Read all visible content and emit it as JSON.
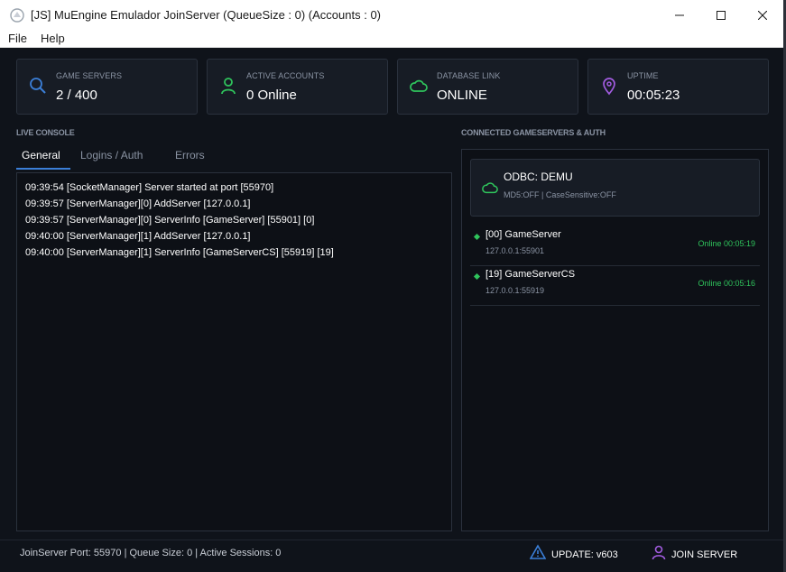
{
  "window": {
    "title": "[JS] MuEngine Emulador JoinServer (QueueSize : 0) (Accounts : 0)"
  },
  "menu": [
    "File",
    "Help"
  ],
  "cards": [
    {
      "label": "GAME SERVERS",
      "value": "2 / 400",
      "icon": "search-icon",
      "color": "#3b7fd8"
    },
    {
      "label": "ACTIVE ACCOUNTS",
      "value": "0 Online",
      "icon": "user-icon",
      "color": "#2fc45c"
    },
    {
      "label": "DATABASE LINK",
      "value": "ONLINE",
      "icon": "cloud-icon",
      "color": "#2fc45c"
    },
    {
      "label": "UPTIME",
      "value": "00:05:23",
      "icon": "location-pin-icon",
      "color": "#a25ce0"
    }
  ],
  "console": {
    "section_label": "LIVE CONSOLE",
    "tabs": [
      "General",
      "Logins / Auth",
      "Errors"
    ],
    "active_tab": "General",
    "lines": [
      "09:39:54 [SocketManager] Server started at port [55970]",
      "09:39:57 [ServerManager][0] AddServer [127.0.0.1]",
      "09:39:57 [ServerManager][0] ServerInfo [GameServer] [55901] [0]",
      "09:40:00 [ServerManager][1] AddServer [127.0.0.1]",
      "09:40:00 [ServerManager][1] ServerInfo [GameServerCS] [55919] [19]"
    ]
  },
  "connected": {
    "section_label": "CONNECTED GAMESERVERS & AUTH",
    "odbc": {
      "title": "ODBC: DEMU",
      "subtitle": "MD5:OFF | CaseSensitive:OFF"
    },
    "servers": [
      {
        "name": "[00] GameServer",
        "address": "127.0.0.1:55901",
        "status": "Online 00:05:19"
      },
      {
        "name": "[19] GameServerCS",
        "address": "127.0.0.1:55919",
        "status": "Online 00:05:16"
      }
    ]
  },
  "statusbar": {
    "text": "JoinServer Port: 55970  |  Queue Size: 0  |  Active Sessions: 0",
    "update_label": "UPDATE: v603",
    "join_label": "JOIN SERVER"
  }
}
